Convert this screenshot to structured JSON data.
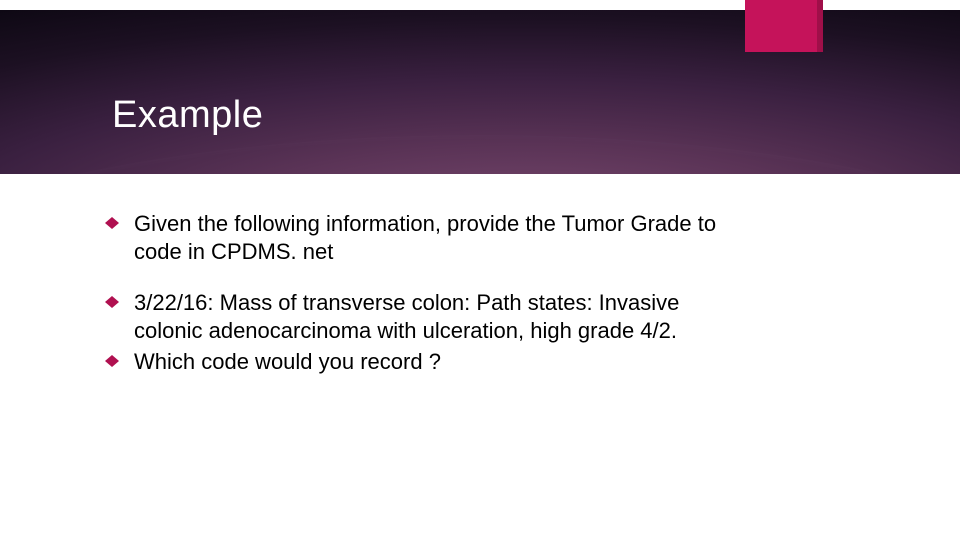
{
  "slide": {
    "title": "Example",
    "bullets": [
      {
        "text": "Given the following information, provide the Tumor Grade to code in CPDMS. net"
      },
      {
        "text": "3/22/16: Mass of transverse colon: Path states: Invasive colonic adenocarcinoma with ulceration, high grade 4/2."
      },
      {
        "text": "Which code would you record ?"
      }
    ]
  },
  "theme": {
    "accent": "#c5135a",
    "bullet_color": "#b01050"
  }
}
